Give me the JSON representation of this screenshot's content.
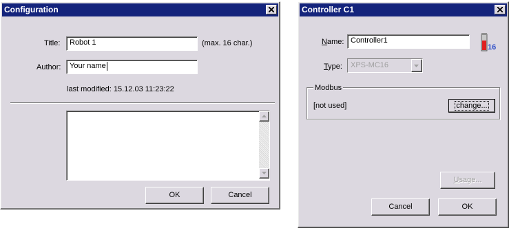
{
  "config_dialog": {
    "title": "Configuration",
    "title_label": "Title:",
    "title_value": "Robot 1",
    "title_hint": "(max. 16 char.)",
    "author_label": "Author:",
    "author_value": "Your name",
    "last_modified": "last modified: 15.12.03 11:23:22",
    "notes_value": "",
    "ok_label": "OK",
    "cancel_label": "Cancel"
  },
  "controller_dialog": {
    "title": "Controller C1",
    "name_label_u": "N",
    "name_label_rest": "ame:",
    "name_value": "Controller1",
    "type_label_u": "T",
    "type_label_rest": "ype:",
    "type_value": "XPS-MC16",
    "icon_badge": "16",
    "modbus_title": "Modbus",
    "modbus_status": "[not used]",
    "change_label": "change...",
    "usage_label_u": "U",
    "usage_label_rest": "sage...",
    "cancel_label": "Cancel",
    "ok_label": "OK"
  },
  "colors": {
    "titlebar": "#14247c",
    "dialog_bg": "#dcd8e0",
    "icon_red": "#e02020",
    "icon_badge": "#3050c8"
  }
}
